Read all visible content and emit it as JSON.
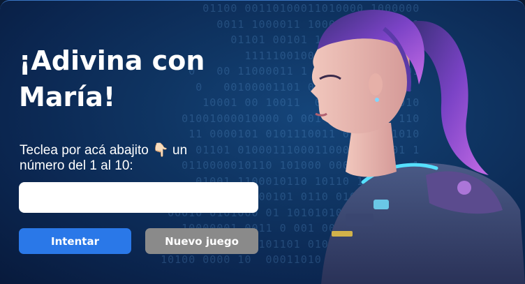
{
  "title": "¡Adivina con María!",
  "prompt": "Teclea por acá abajito 👇🏻 un número del 1 al 10:",
  "guess_input": {
    "value": "",
    "placeholder": ""
  },
  "buttons": {
    "try_label": "Intentar",
    "new_game_label": "Nuevo juego"
  },
  "background_binary": [
    "         01100 00110100011010000 1000000",
    "           0011 1000011 1000101011  0001",
    "             01101 00101 1011101 0011010",
    "               1111100100 00001100  0011",
    "       0   00 11000011 1 000 0  1 00 101",
    "        0   00100001101 00  0 10001  01",
    "         10001 00 10011  0101 11 0010010",
    "      01001000010000 0 001 101101 10 110",
    "       11 0000101 0101110011 0  001 1010",
    "        01101 010001110001100011010001 1",
    "      0110000010110 101000 000111 001  1",
    "        01001 1100010110 10110 1010 0 101",
    "   11010001  101000101 0110 01011 0101",
    "    00010 0101000 01 10101010 00010 011",
    "      10000001 0011 0 001 00110101 0010",
    "      00 01111   101101 0100 1000 11100",
    "   10100 0000 10  00011010 0101010 00 01"
  ],
  "colors": {
    "background": "#0f3563",
    "primary_button": "#2a78e8",
    "secondary_button": "#8a8a8a",
    "text": "#ffffff"
  }
}
